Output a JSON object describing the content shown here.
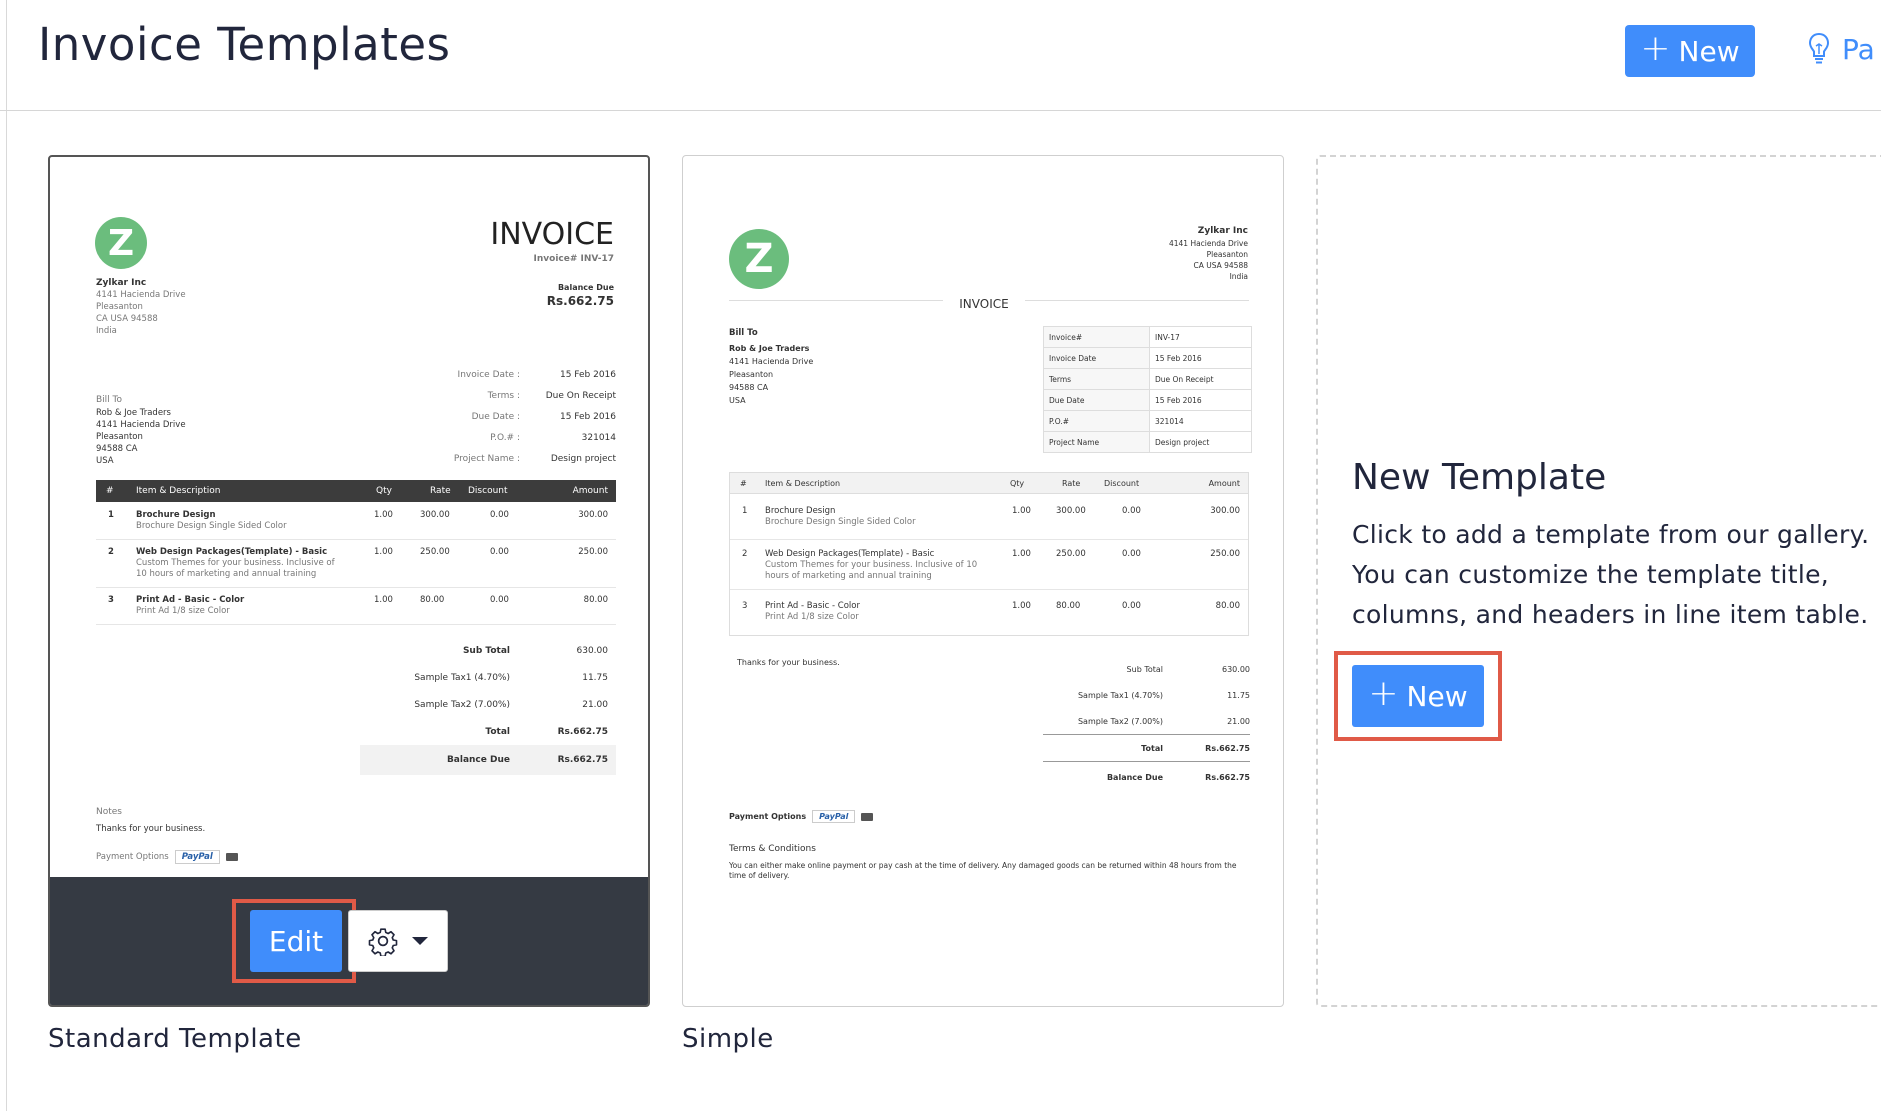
{
  "header": {
    "title": "Invoice Templates",
    "new_label": "New",
    "tip_label": "Pa"
  },
  "templates": [
    {
      "name": "Standard Template",
      "edit_label": "Edit",
      "preview": {
        "invoice_title": "INVOICE",
        "invoice_no": "Invoice# INV-17",
        "balance_due_label": "Balance Due",
        "balance_due": "Rs.662.75",
        "company": "Zylkar Inc",
        "company_addr": [
          "4141 Hacienda Drive",
          "Pleasanton",
          "CA USA 94588",
          "India"
        ],
        "bill_to_label": "Bill To",
        "bill_to": [
          "Rob & Joe Traders",
          "4141 Hacienda Drive",
          "Pleasanton",
          "94588 CA",
          "USA"
        ],
        "meta": [
          {
            "k": "Invoice Date :",
            "v": "15 Feb 2016"
          },
          {
            "k": "Terms :",
            "v": "Due On Receipt"
          },
          {
            "k": "Due Date :",
            "v": "15 Feb 2016"
          },
          {
            "k": "P.O.# :",
            "v": "321014"
          },
          {
            "k": "Project Name :",
            "v": "Design project"
          }
        ],
        "cols": [
          "#",
          "Item & Description",
          "Qty",
          "Rate",
          "Discount",
          "Amount"
        ],
        "items": [
          {
            "n": "1",
            "name": "Brochure Design",
            "desc": "Brochure Design Single Sided Color",
            "qty": "1.00",
            "rate": "300.00",
            "disc": "0.00",
            "amt": "300.00"
          },
          {
            "n": "2",
            "name": "Web Design Packages(Template) - Basic",
            "desc": "Custom Themes for your business. Inclusive of 10 hours of marketing and annual training",
            "qty": "1.00",
            "rate": "250.00",
            "disc": "0.00",
            "amt": "250.00"
          },
          {
            "n": "3",
            "name": "Print Ad - Basic - Color",
            "desc": "Print Ad 1/8 size Color",
            "qty": "1.00",
            "rate": "80.00",
            "disc": "0.00",
            "amt": "80.00"
          }
        ],
        "totals": [
          {
            "k": "Sub Total",
            "v": "630.00"
          },
          {
            "k": "Sample Tax1 (4.70%)",
            "v": "11.75"
          },
          {
            "k": "Sample Tax2 (7.00%)",
            "v": "21.00"
          },
          {
            "k": "Total",
            "v": "Rs.662.75"
          },
          {
            "k": "Balance Due",
            "v": "Rs.662.75"
          }
        ],
        "notes_label": "Notes",
        "notes": "Thanks for your business.",
        "payment_label": "Payment Options",
        "paypal": "PayPal"
      }
    },
    {
      "name": "Simple",
      "preview": {
        "invoice_title": "INVOICE",
        "company": "Zylkar Inc",
        "company_addr": [
          "4141 Hacienda Drive",
          "Pleasanton",
          "CA USA 94588",
          "India"
        ],
        "bill_to_label": "Bill To",
        "bill_to": [
          "Rob & Joe Traders",
          "4141 Hacienda Drive",
          "Pleasanton",
          "94588 CA",
          "USA"
        ],
        "meta": [
          {
            "k": "Invoice#",
            "v": "INV-17"
          },
          {
            "k": "Invoice Date",
            "v": "15 Feb 2016"
          },
          {
            "k": "Terms",
            "v": "Due On Receipt"
          },
          {
            "k": "Due Date",
            "v": "15 Feb 2016"
          },
          {
            "k": "P.O.#",
            "v": "321014"
          },
          {
            "k": "Project Name",
            "v": "Design project"
          }
        ],
        "cols": [
          "#",
          "Item & Description",
          "Qty",
          "Rate",
          "Discount",
          "Amount"
        ],
        "items": [
          {
            "n": "1",
            "name": "Brochure Design",
            "desc": "Brochure Design Single Sided Color",
            "qty": "1.00",
            "rate": "300.00",
            "disc": "0.00",
            "amt": "300.00"
          },
          {
            "n": "2",
            "name": "Web Design Packages(Template) - Basic",
            "desc": "Custom Themes for your business. Inclusive of 10 hours of marketing and annual training",
            "qty": "1.00",
            "rate": "250.00",
            "disc": "0.00",
            "amt": "250.00"
          },
          {
            "n": "3",
            "name": "Print Ad - Basic - Color",
            "desc": "Print Ad 1/8 size Color",
            "qty": "1.00",
            "rate": "80.00",
            "disc": "0.00",
            "amt": "80.00"
          }
        ],
        "thanks": "Thanks for your business.",
        "totals": [
          {
            "k": "Sub Total",
            "v": "630.00"
          },
          {
            "k": "Sample Tax1 (4.70%)",
            "v": "11.75"
          },
          {
            "k": "Sample Tax2 (7.00%)",
            "v": "21.00"
          },
          {
            "k": "Total",
            "v": "Rs.662.75"
          },
          {
            "k": "Balance Due",
            "v": "Rs.662.75"
          }
        ],
        "payment_label": "Payment Options",
        "paypal": "PayPal",
        "terms_label": "Terms & Conditions",
        "terms": "You can either make online payment or pay cash at the time of delivery. Any damaged goods can be returned within 48 hours from the time of delivery."
      }
    }
  ],
  "new_template": {
    "title": "New Template",
    "description": "Click to add a template from our gallery. You can customize the template title, columns, and headers in line item table.",
    "button_label": "New"
  },
  "colors": {
    "accent": "#408dfb",
    "highlight": "#e05a47",
    "logo": "#6bbd7d",
    "dark": "#353a43"
  }
}
